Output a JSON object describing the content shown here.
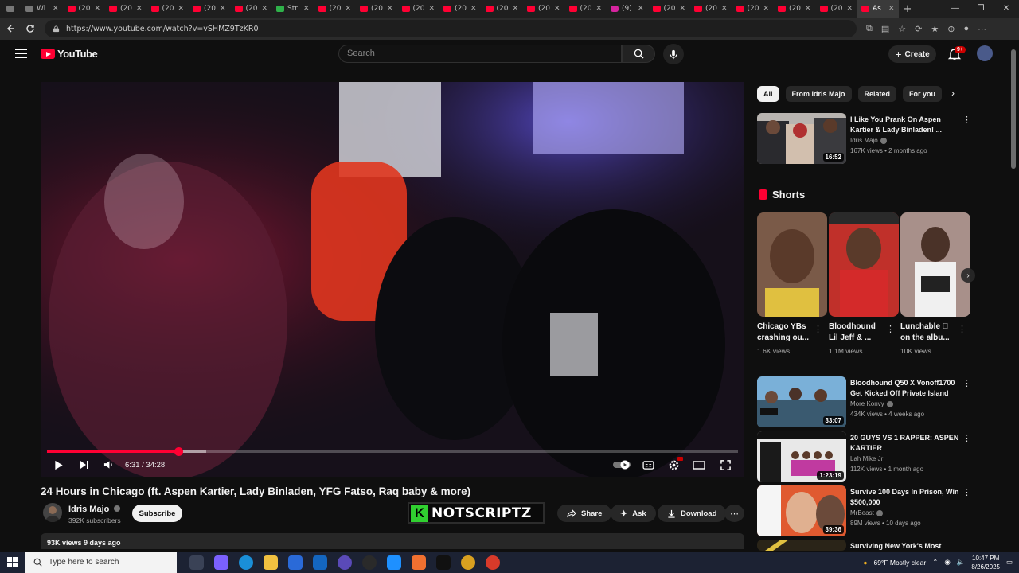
{
  "browser": {
    "tabs": [
      {
        "label": "",
        "icon": "window-icon",
        "kind": "first"
      },
      {
        "label": "Wi",
        "icon": "doc-icon",
        "kind": "plain"
      },
      {
        "label": "(20",
        "icon": "youtube-icon",
        "kind": "yt"
      },
      {
        "label": "(20",
        "icon": "youtube-icon",
        "kind": "yt"
      },
      {
        "label": "(20",
        "icon": "youtube-icon",
        "kind": "yt"
      },
      {
        "label": "(20",
        "icon": "youtube-icon",
        "kind": "yt"
      },
      {
        "label": "(20",
        "icon": "youtube-icon",
        "kind": "yt"
      },
      {
        "label": "Str",
        "icon": "kick-icon",
        "kind": "green"
      },
      {
        "label": "(20",
        "icon": "youtube-icon",
        "kind": "yt"
      },
      {
        "label": "(20",
        "icon": "youtube-icon",
        "kind": "yt"
      },
      {
        "label": "(20",
        "icon": "youtube-icon",
        "kind": "yt"
      },
      {
        "label": "(20",
        "icon": "youtube-icon",
        "kind": "yt"
      },
      {
        "label": "(20",
        "icon": "youtube-icon",
        "kind": "yt"
      },
      {
        "label": "(20",
        "icon": "youtube-icon",
        "kind": "yt"
      },
      {
        "label": "(20",
        "icon": "youtube-icon",
        "kind": "yt"
      },
      {
        "label": "(9)",
        "icon": "instagram-icon",
        "kind": "ig"
      },
      {
        "label": "(20",
        "icon": "youtube-icon",
        "kind": "yt"
      },
      {
        "label": "(20",
        "icon": "youtube-icon",
        "kind": "yt"
      },
      {
        "label": "(20",
        "icon": "youtube-icon",
        "kind": "yt"
      },
      {
        "label": "(20",
        "icon": "youtube-icon",
        "kind": "yt"
      },
      {
        "label": "(20",
        "icon": "youtube-icon",
        "kind": "yt"
      },
      {
        "label": "As",
        "icon": "youtube-icon",
        "kind": "active"
      }
    ],
    "new_tab": "+",
    "window_controls": [
      "—",
      "❐",
      "✕"
    ],
    "url": "https://www.youtube.com/watch?v=vSHMZ9TzKR0"
  },
  "header": {
    "logo_text": "YouTube",
    "search_placeholder": "Search",
    "create_label": "Create",
    "notification_count": "9+"
  },
  "player": {
    "current_time": "6:31",
    "duration": "34:28",
    "time_display": "6:31 / 34:28",
    "played_fraction": 0.19,
    "buffered_fraction": 0.23
  },
  "video": {
    "title": "24 Hours in Chicago (ft. Aspen Kartier, Lady Binladen, YFG Fatso, Raq baby & more)",
    "channel": "Idris Majo",
    "subscribers": "392K subscribers",
    "subscribe_label": "Subscribe",
    "watermark": "NOTSCRIPTZ",
    "watermark_letter": "K",
    "share_label": "Share",
    "ask_label": "Ask",
    "download_label": "Download",
    "description_meta": "93K views  9 days ago"
  },
  "sidebar": {
    "chips": [
      {
        "label": "All",
        "active": true
      },
      {
        "label": "From Idris Majo",
        "active": false
      },
      {
        "label": "Related",
        "active": false
      },
      {
        "label": "For you",
        "active": false
      }
    ],
    "top_rec": {
      "title": "I Like You Prank On Aspen Kartier & Lady Binladen! ...",
      "channel": "Idris Majo",
      "meta": "167K views • 2 months ago",
      "duration": "16:52"
    },
    "shorts_heading": "Shorts",
    "shorts": [
      {
        "title": "Chicago YBs crashing ou...",
        "views": "1.6K views"
      },
      {
        "title": "Bloodhound Lil Jeff & ...",
        "views": "1.1M views"
      },
      {
        "title": "Lunchable 🏽 on the albu...",
        "views": "10K views"
      }
    ],
    "recs": [
      {
        "title": "Bloodhound Q50 X Vonoff1700 Get Kicked Off Private Island",
        "channel": "More Konvy",
        "meta": "434K views • 4 weeks ago",
        "duration": "33:07"
      },
      {
        "title": "20 GUYS VS 1 RAPPER: ASPEN KARTIER",
        "channel": "Lah Mike Jr",
        "meta": "112K views • 1 month ago",
        "duration": "1:23:19"
      },
      {
        "title": "Survive 100 Days In Prison, Win $500,000",
        "channel": "MrBeast",
        "meta": "89M views • 10 days ago",
        "duration": "39:36"
      },
      {
        "title": "Surviving New York's Most",
        "channel": "",
        "meta": "",
        "duration": ""
      }
    ]
  },
  "taskbar": {
    "search_placeholder": "Type here to search",
    "weather": "69°F  Mostly clear",
    "time": "10:47 PM",
    "date": "8/26/2025"
  },
  "colors": {
    "background": "#0f0f0f",
    "accent_red": "#ff0033",
    "chip_bg": "#272727",
    "watermark_green": "#30d030"
  }
}
